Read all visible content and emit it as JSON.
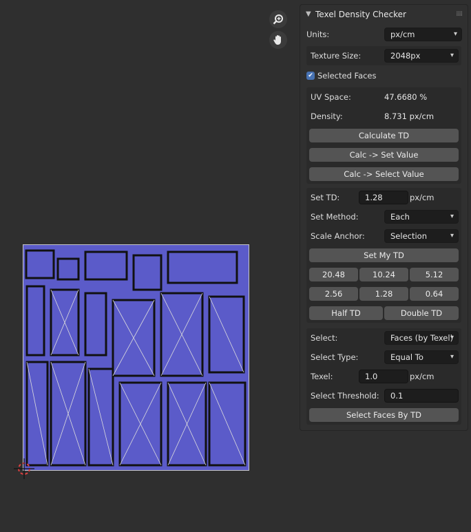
{
  "panel": {
    "title": "Texel Density Checker",
    "units_label": "Units:",
    "units_value": "px/cm",
    "texture_label": "Texture Size:",
    "texture_value": "2048px",
    "selected_faces_label": "Selected Faces",
    "selected_faces_checked": true,
    "uv_space_label": "UV Space:",
    "uv_space_value": "47.6680 %",
    "density_label": "Density:",
    "density_value": "8.731 px/cm",
    "calculate_label": "Calculate TD",
    "calc_set_label": "Calc -> Set Value",
    "calc_select_label": "Calc -> Select Value",
    "set_td_label": "Set TD:",
    "set_td_value": "1.28",
    "set_td_unit": "px/cm",
    "set_method_label": "Set Method:",
    "set_method_value": "Each",
    "scale_anchor_label": "Scale Anchor:",
    "scale_anchor_value": "Selection",
    "set_my_td_label": "Set My TD",
    "presets": [
      "20.48",
      "10.24",
      "5.12",
      "2.56",
      "1.28",
      "0.64"
    ],
    "half_label": "Half TD",
    "double_label": "Double TD",
    "select_label": "Select:",
    "select_value": "Faces (by Texel)",
    "select_type_label": "Select Type:",
    "select_type_value": "Equal To",
    "texel_label": "Texel:",
    "texel_value": "1.0",
    "texel_unit": "px/cm",
    "threshold_label": "Select Threshold:",
    "threshold_value": "0.1",
    "select_faces_label": "Select Faces By TD"
  },
  "colors": {
    "uv_fill": "#5b5bc9",
    "button": "#545454",
    "checkbox": "#4772b3"
  },
  "icons": [
    "zoom-icon",
    "hand-pan-icon",
    "cursor-3d-icon",
    "chevron-down-icon",
    "drag-grip-icon",
    "checkmark-icon"
  ]
}
